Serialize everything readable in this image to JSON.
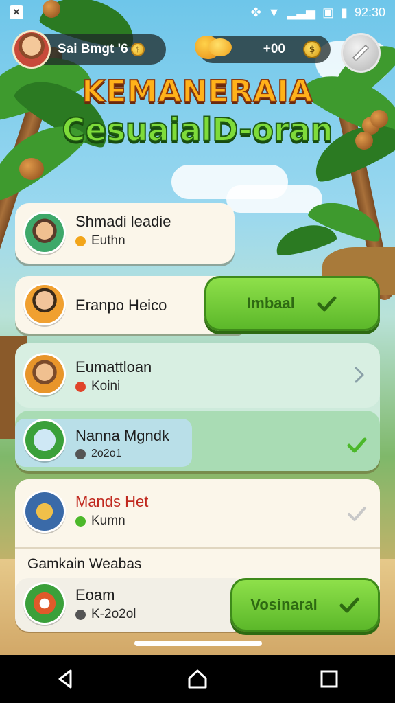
{
  "status_bar": {
    "time": "92:30"
  },
  "hud": {
    "player_name": "Sai Bmgt '6",
    "currency_amount": "+00",
    "icons": {
      "settings": "wrench-icon",
      "coin": "coin-icon"
    }
  },
  "title": {
    "line1": "KEMANERAIA",
    "line2": "CesuaialD-oran"
  },
  "cards": [
    {
      "name": "Shmadi leadie",
      "sub": "Euthn",
      "dot_color": "#f2a51a"
    },
    {
      "name": "Eranpo Heico",
      "button": "Imbaal"
    },
    {
      "name": "Eumattloan",
      "sub": "Koini",
      "dot_color": "#e0442a"
    },
    {
      "name": "Nanna Mgndk",
      "sub": "2o2o1"
    },
    {
      "name": "Mands Het",
      "sub": "Kumn",
      "dot_color": "#4cb82a"
    }
  ],
  "section": {
    "label": "Gamkain Weabas"
  },
  "last_card": {
    "name": "Eoam",
    "sub": "K-2o2ol",
    "button": "Vosinaral"
  },
  "colors": {
    "title_orange": "#ffb21a",
    "title_green": "#7edb3a",
    "button_green": "#6cc832",
    "card_bg": "#fbf6ea",
    "highlight_teal": "#bfe6d2"
  }
}
